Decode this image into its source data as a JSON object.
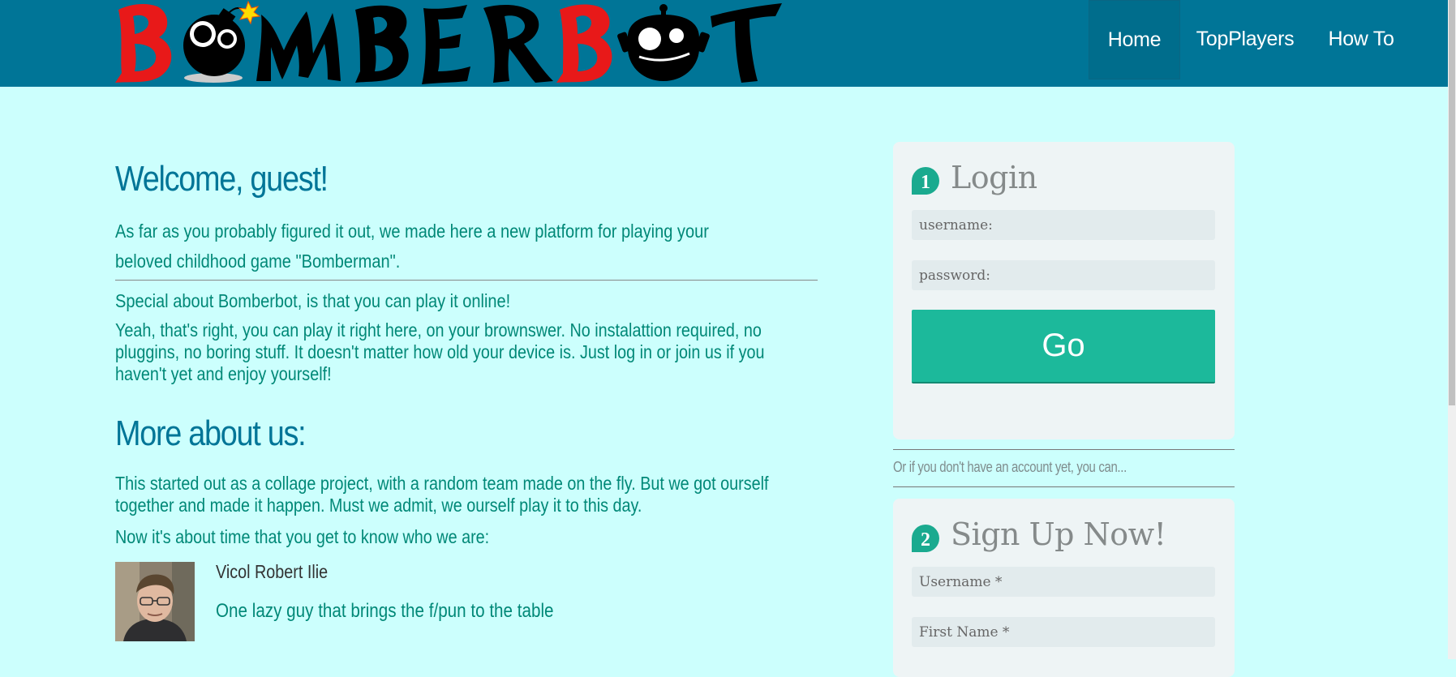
{
  "header": {
    "logo_text": "BOMBERBOT",
    "nav": [
      {
        "label": "Home",
        "active": true
      },
      {
        "label": "TopPlayers",
        "active": false
      },
      {
        "label": "How To",
        "active": false
      }
    ],
    "colors": {
      "bar": "#007597",
      "logo_red": "#e81919",
      "logo_black": "#000000"
    }
  },
  "main": {
    "welcome_title": "Welcome, guest!",
    "intro": "As far as you probably figured it out, we made here a new platform for playing your beloved childhood game \"Bomberman\".",
    "special": "Special about Bomberbot, is that you can play it online!",
    "yeah": "Yeah, that's right, you can play it right here, on your brownswer. No instalattion required, no pluggins, no boring stuff. It doesn't matter how old your device is. Just log in or join us if you haven't yet and enjoy yourself!",
    "more_title": "More about us:",
    "collage": "This started out as a collage project, with a random team made on the fly. But we got ourself together and made it happen. Must we admit, we ourself play it to this day.",
    "now": "Now it's about time that you get to know who we are:",
    "members": [
      {
        "name": "Vicol Robert Ilie",
        "description": "One lazy guy that brings the f/pun to the table"
      }
    ]
  },
  "login": {
    "step": "1",
    "title": "Login",
    "username_placeholder": "username:",
    "password_placeholder": "password:",
    "go_label": "Go"
  },
  "or_text": "Or if you don't have an account yet, you can...",
  "signup": {
    "step": "2",
    "title": "Sign Up Now!",
    "username_placeholder": "Username *",
    "firstname_placeholder": "First Name *"
  }
}
